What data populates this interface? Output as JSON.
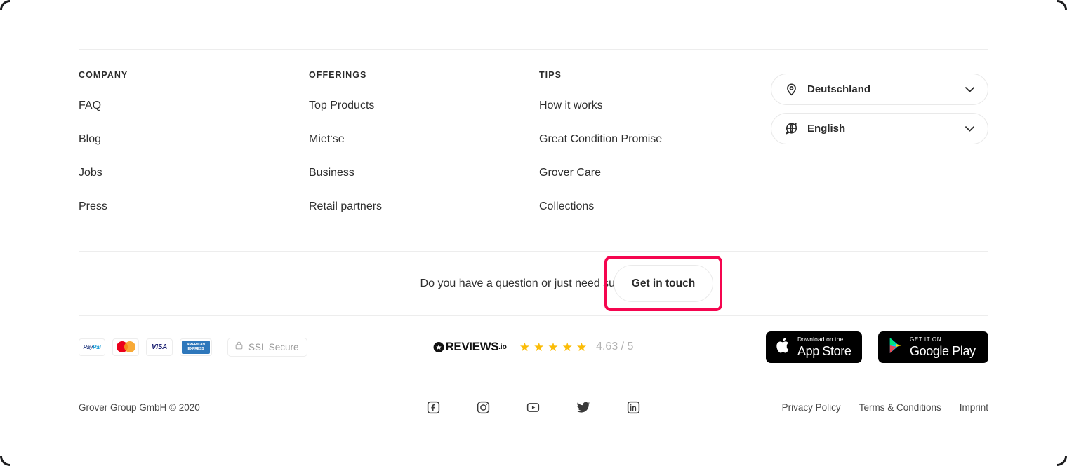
{
  "columns": [
    {
      "heading": "COMPANY",
      "links": [
        "FAQ",
        "Blog",
        "Jobs",
        "Press"
      ]
    },
    {
      "heading": "OFFERINGS",
      "links": [
        "Top Products",
        "Miet‘se",
        "Business",
        "Retail partners"
      ]
    },
    {
      "heading": "TIPS",
      "links": [
        "How it works",
        "Great Condition Promise",
        "Grover Care",
        "Collections"
      ]
    }
  ],
  "selectors": [
    {
      "icon": "location-pin-icon",
      "value": "Deutschland"
    },
    {
      "icon": "globe-icon",
      "value": "English"
    }
  ],
  "cta": {
    "question": "Do you have a question or just need support?",
    "button_label": "Get in touch",
    "highlight_color": "#f5054f"
  },
  "payments": [
    {
      "name": "paypal-logo",
      "label": "PayPal"
    },
    {
      "name": "mastercard-logo",
      "label": "Mastercard"
    },
    {
      "name": "visa-logo",
      "label": "VISA"
    },
    {
      "name": "american-express-logo",
      "label": "AMERICAN EXPRESS"
    }
  ],
  "ssl": {
    "icon": "lock-icon",
    "label": "SSL Secure"
  },
  "reviews": {
    "brand": "REVIEWS",
    "brand_suffix": ".io",
    "stars": 5,
    "star_color": "#fbbc06",
    "score": "4.63 / 5"
  },
  "stores": [
    {
      "name": "app-store-badge",
      "top": "Download on the",
      "bottom": "App Store"
    },
    {
      "name": "google-play-badge",
      "top": "GET IT ON",
      "bottom": "Google Play"
    }
  ],
  "bottom": {
    "copyright": "Grover Group GmbH © 2020",
    "socials": [
      "facebook-icon",
      "instagram-icon",
      "youtube-icon",
      "twitter-icon",
      "linkedin-icon"
    ],
    "legal": [
      "Privacy Policy",
      "Terms & Conditions",
      "Imprint"
    ]
  }
}
